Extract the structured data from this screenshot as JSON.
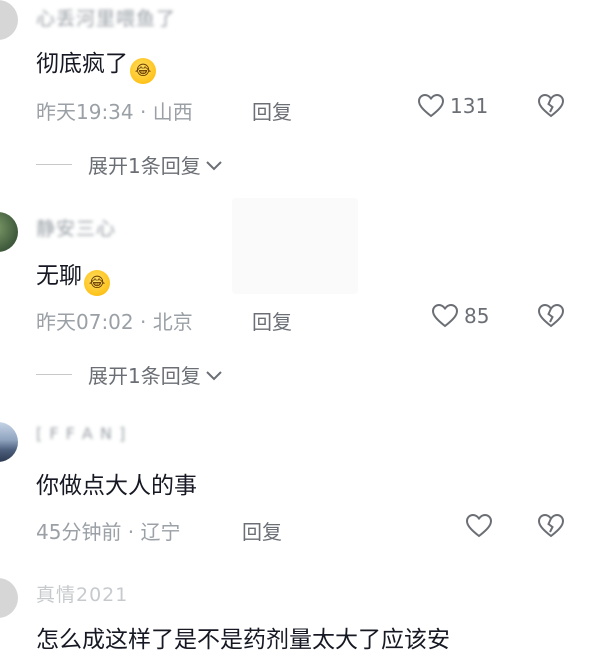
{
  "comments": [
    {
      "username": "心丢河里喂鱼了",
      "text": "彻底疯了",
      "time_location": "昨天19:34 · 山西",
      "reply_label": "回复",
      "likes": "131",
      "expand_label": "展开1条回复"
    },
    {
      "username": "静安三心",
      "text": "无聊",
      "time_location": "昨天07:02 · 北京",
      "reply_label": "回复",
      "likes": "85",
      "expand_label": "展开1条回复"
    },
    {
      "username": "[ F F A N ]",
      "text": "你做点大人的事",
      "time_location": "45分钟前 · 辽宁",
      "reply_label": "回复",
      "likes": ""
    },
    {
      "username": "真情2021",
      "text": "怎么成这样了是不是药剂量太大了应该安"
    }
  ],
  "icons": {
    "emoji": "laughing-crying-emoji-icon",
    "like": "heart-outline-icon",
    "dislike": "broken-heart-icon",
    "chevron": "chevron-down-icon"
  },
  "colors": {
    "primary_text": "#161823",
    "secondary_text": "#9aa0a6",
    "action_text": "#6b6f75"
  }
}
